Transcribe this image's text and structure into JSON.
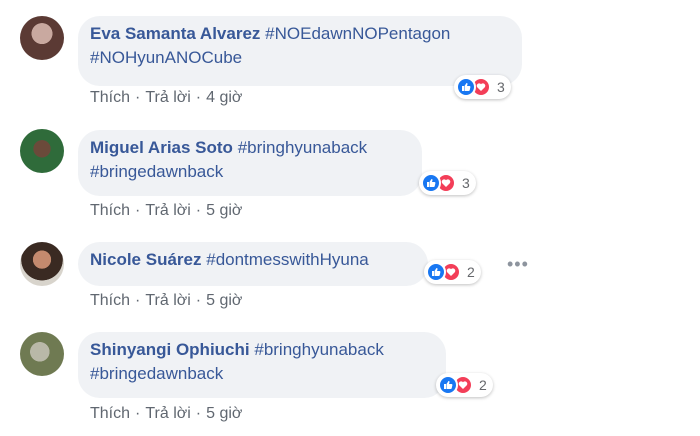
{
  "comments": [
    {
      "name": "Eva Samanta Alvarez",
      "tags_line1": "#NOEdawnNOPentagon",
      "line2": "#NOHyunANOCube",
      "reactions": "3",
      "like": "Thích",
      "reply": "Trả lời",
      "time": "4 giờ"
    },
    {
      "name": "Miguel Arias Soto",
      "tags_line1": "#bringhyunaback",
      "line2": "#bringedawnback",
      "reactions": "3",
      "like": "Thích",
      "reply": "Trả lời",
      "time": "5 giờ"
    },
    {
      "name": "Nicole Suárez",
      "tags_line1": "#dontmesswithHyuna",
      "line2": "",
      "reactions": "2",
      "like": "Thích",
      "reply": "Trả lời",
      "time": "5 giờ"
    },
    {
      "name": "Shinyangi Ophiuchi",
      "tags_line1": "#bringhyunaback",
      "line2": "#bringedawnback",
      "reactions": "2",
      "like": "Thích",
      "reply": "Trả lời",
      "time": "5 giờ"
    }
  ],
  "separator": "·",
  "more_options": "•••",
  "icons": [
    "like-icon",
    "love-icon",
    "more-options-icon"
  ],
  "colors": {
    "name": "#385898",
    "bubble": "#f0f2f5",
    "like": "#1877f2",
    "love": "#f33e58"
  }
}
